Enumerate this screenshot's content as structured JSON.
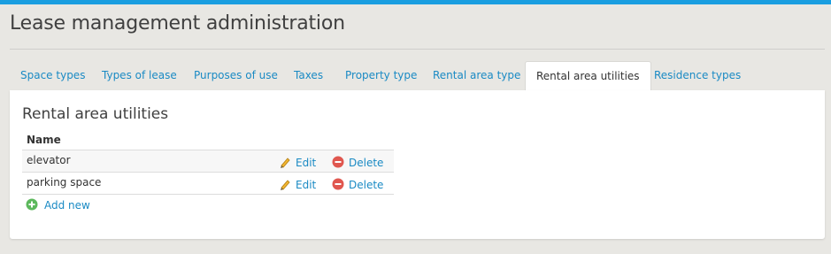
{
  "page": {
    "title": "Lease management administration"
  },
  "tabs": [
    {
      "label": "Space types"
    },
    {
      "label": "Types of lease"
    },
    {
      "label": "Purposes of use"
    },
    {
      "label": "Taxes"
    },
    {
      "label": "Property type"
    },
    {
      "label": "Rental area type"
    },
    {
      "label": "Rental area utilities",
      "active": true
    },
    {
      "label": "Residence types"
    }
  ],
  "panel": {
    "title": "Rental area utilities",
    "table": {
      "header": "Name",
      "rows": [
        {
          "name": "elevator",
          "edit": "Edit",
          "delete": "Delete"
        },
        {
          "name": "parking space",
          "edit": "Edit",
          "delete": "Delete"
        }
      ]
    },
    "add_new": "Add new"
  },
  "icons": {
    "edit": "pencil-icon",
    "delete": "minus-circle-icon",
    "add": "plus-circle-icon"
  },
  "colors": {
    "accent": "#1a9ee0",
    "link": "#1a8ac4",
    "delete": "#e0574f",
    "add": "#5cb85c"
  }
}
